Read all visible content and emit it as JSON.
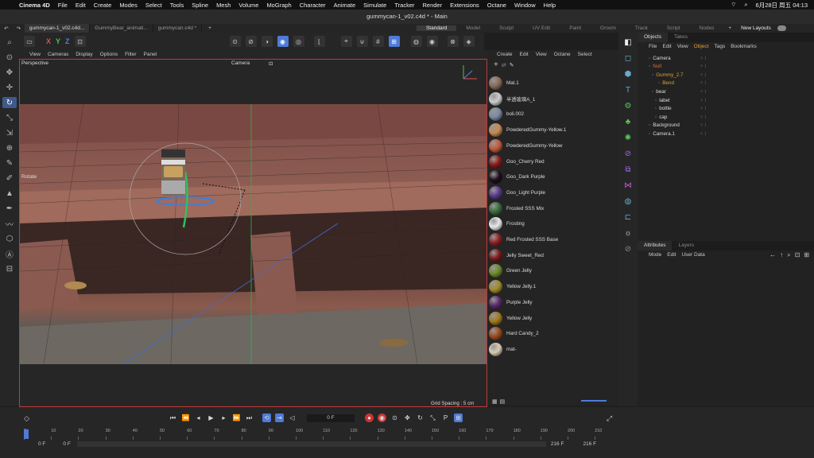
{
  "mac_menu": {
    "app": "Cinema 4D",
    "items": [
      "File",
      "Edit",
      "Create",
      "Modes",
      "Select",
      "Tools",
      "Spline",
      "Mesh",
      "Volume",
      "MoGraph",
      "Character",
      "Animate",
      "Simulate",
      "Tracker",
      "Render",
      "Extensions",
      "Octane",
      "Window",
      "Help"
    ],
    "date_time": "6月28日 周五  04:13"
  },
  "window_title": "gummycan-1_v02.c4d * - Main",
  "doc_tabs": [
    "gummycan-1_v02.c4d...",
    "GummyBear_animati...",
    "gummycan.c4d *"
  ],
  "layouts": [
    "Standard",
    "Model",
    "Sculpt",
    "UV Edit",
    "Paint",
    "Groom",
    "Track",
    "Script",
    "Nodes"
  ],
  "active_layout": "Standard",
  "new_layouts_label": "New Layouts",
  "viewport": {
    "menu": [
      "View",
      "Cameras",
      "Display",
      "Options",
      "Filter",
      "Panel"
    ],
    "label": "Perspective",
    "camera_label": "Camera",
    "tool_label": "Rotate",
    "grid_spacing": "Grid Spacing : 5 cm"
  },
  "material_panel": {
    "menu": [
      "Create",
      "Edit",
      "View",
      "Octane",
      "Select"
    ],
    "materials": [
      {
        "name": "Mat.1",
        "color": "#8a6a5a"
      },
      {
        "name": "半透玻璃A_1",
        "color": "#ccc"
      },
      {
        "name": "boli.002",
        "color": "#7a8aa0"
      },
      {
        "name": "PowderedGummy-Yellow.1",
        "color": "#c9884f"
      },
      {
        "name": "PowderedGummy-Yellow",
        "color": "#c4583c"
      },
      {
        "name": "Goo_Cherry Red",
        "color": "#8a1a1a"
      },
      {
        "name": "Goo_Dark Purple",
        "color": "#1e1020"
      },
      {
        "name": "Goo_Light Purple",
        "color": "#5a3a8a"
      },
      {
        "name": "Frosted SSS Mix",
        "color": "#3a6a3a"
      },
      {
        "name": "Frosting",
        "color": "#e8e8e8"
      },
      {
        "name": "Red Frosted SSS Base",
        "color": "#8a2020"
      },
      {
        "name": "Jelly Sweet_Red",
        "color": "#7a1a1a"
      },
      {
        "name": "Green Jelly",
        "color": "#6a8a2a"
      },
      {
        "name": "Yellow Jelly.1",
        "color": "#a08a2a"
      },
      {
        "name": "Purple Jelly",
        "color": "#5a2a6a"
      },
      {
        "name": "Yellow Jelly",
        "color": "#a07a1a"
      },
      {
        "name": "Hard Candy_2",
        "color": "#9a4a1a"
      },
      {
        "name": "mat-",
        "color": "#d8cbb0"
      }
    ]
  },
  "object_panel": {
    "tabs": [
      "Objects",
      "Takes"
    ],
    "menu": [
      "File",
      "Edit",
      "View",
      "Object",
      "Tags",
      "Bookmarks"
    ],
    "objects": [
      {
        "name": "Camera",
        "color": "#ddd"
      },
      {
        "name": "Null",
        "color": "#e06a3a"
      },
      {
        "name": "Gummy_2.7",
        "color": "#e0a030"
      },
      {
        "name": "Bend",
        "color": "#e0a030"
      },
      {
        "name": "bear",
        "color": "#ddd"
      },
      {
        "name": "label",
        "color": "#ddd"
      },
      {
        "name": "bottle",
        "color": "#ddd"
      },
      {
        "name": "cap",
        "color": "#ddd"
      },
      {
        "name": "Background",
        "color": "#ddd"
      },
      {
        "name": "Camera.1",
        "color": "#ddd"
      }
    ]
  },
  "attr_panel": {
    "tabs": [
      "Attributes",
      "Layers"
    ],
    "menu": [
      "Mode",
      "Edit",
      "User Data"
    ]
  },
  "timeline": {
    "current_frame": "0 F",
    "start": "0 F",
    "start2": "0 F",
    "end": "216 F",
    "end2": "216 F",
    "ticks": [
      "0",
      "10",
      "20",
      "30",
      "40",
      "50",
      "60",
      "70",
      "80",
      "90",
      "100",
      "110",
      "120",
      "130",
      "140",
      "150",
      "160",
      "170",
      "180",
      "190",
      "200",
      "210"
    ]
  }
}
